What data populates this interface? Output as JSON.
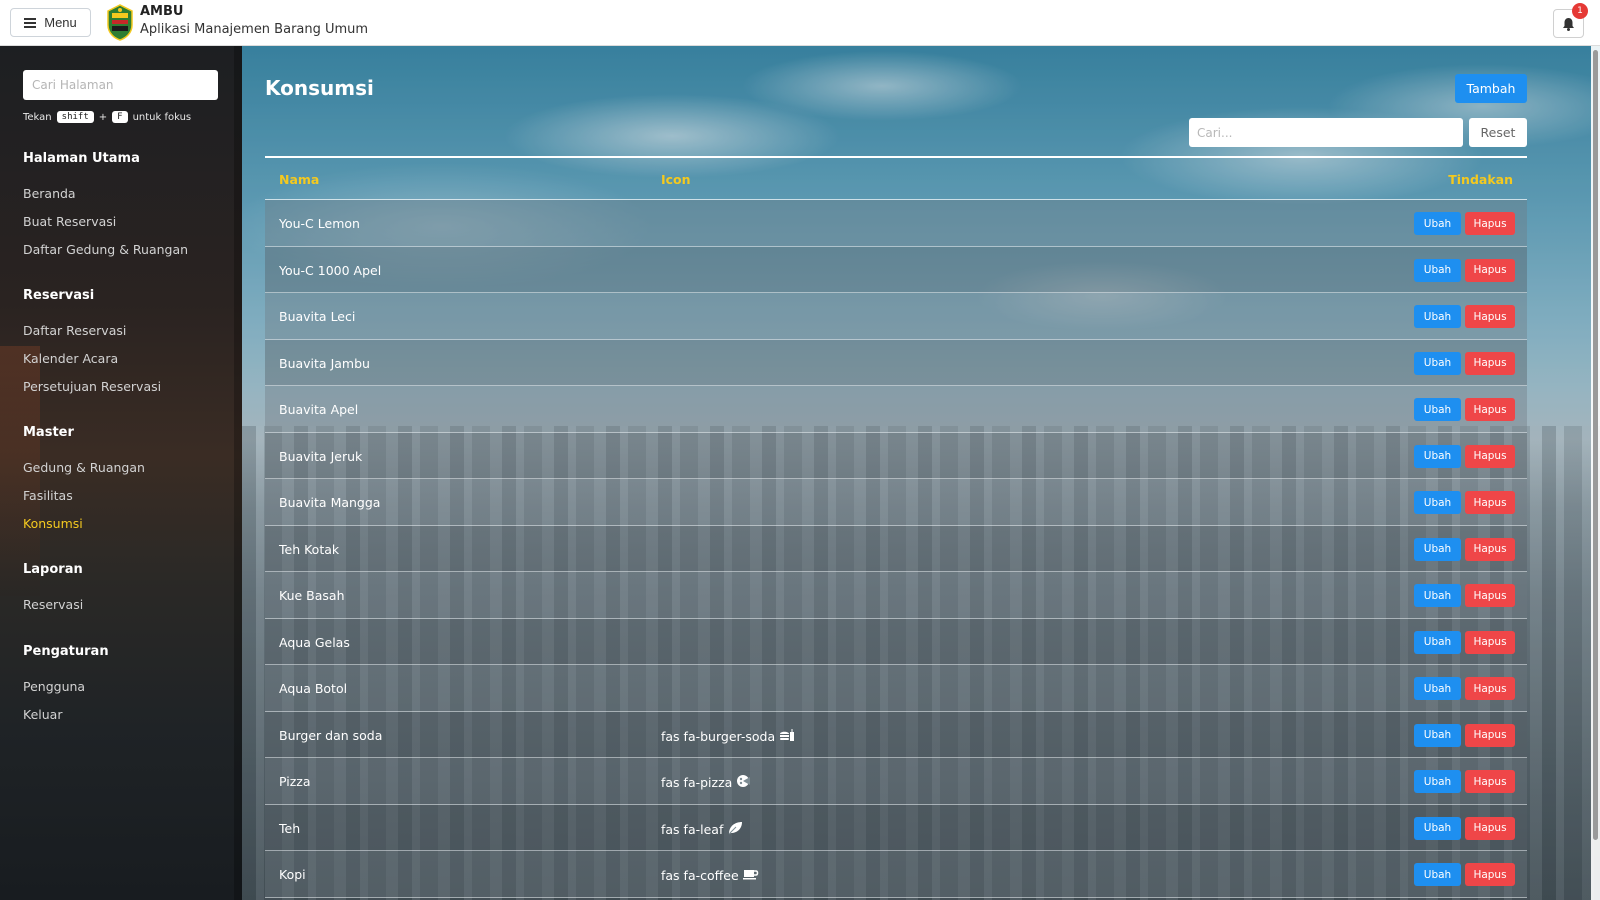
{
  "header": {
    "menu_label": "Menu",
    "app_title": "AMBU",
    "app_subtitle": "Aplikasi Manajemen Barang Umum",
    "notification_count": "1"
  },
  "sidebar": {
    "search_placeholder": "Cari Halaman",
    "hint": {
      "prefix": "Tekan",
      "key1": "shift",
      "plus": "+",
      "key2": "F",
      "suffix": "untuk fokus"
    },
    "sections": [
      {
        "title": "Halaman Utama",
        "items": [
          "Beranda",
          "Buat Reservasi",
          "Daftar Gedung & Ruangan"
        ]
      },
      {
        "title": "Reservasi",
        "items": [
          "Daftar Reservasi",
          "Kalender Acara",
          "Persetujuan Reservasi"
        ]
      },
      {
        "title": "Master",
        "items": [
          "Gedung & Ruangan",
          "Fasilitas",
          "Konsumsi"
        ]
      },
      {
        "title": "Laporan",
        "items": [
          "Reservasi"
        ]
      },
      {
        "title": "Pengaturan",
        "items": [
          "Pengguna",
          "Keluar"
        ]
      }
    ],
    "active_item": "Konsumsi"
  },
  "main": {
    "title": "Konsumsi",
    "add_label": "Tambah",
    "search_placeholder": "Cari...",
    "reset_label": "Reset",
    "columns": {
      "nama": "Nama",
      "icon": "Icon",
      "tindakan": "Tindakan"
    },
    "edit_label": "Ubah",
    "delete_label": "Hapus",
    "rows": [
      {
        "nama": "You-C Lemon",
        "icon": ""
      },
      {
        "nama": "You-C 1000 Apel",
        "icon": ""
      },
      {
        "nama": "Buavita Leci",
        "icon": ""
      },
      {
        "nama": "Buavita Jambu",
        "icon": ""
      },
      {
        "nama": "Buavita Apel",
        "icon": ""
      },
      {
        "nama": "Buavita Jeruk",
        "icon": ""
      },
      {
        "nama": "Buavita Mangga",
        "icon": ""
      },
      {
        "nama": "Teh Kotak",
        "icon": ""
      },
      {
        "nama": "Kue Basah",
        "icon": ""
      },
      {
        "nama": "Aqua Gelas",
        "icon": ""
      },
      {
        "nama": "Aqua Botol",
        "icon": ""
      },
      {
        "nama": "Burger dan soda",
        "icon": "fas fa-burger-soda",
        "glyph": "burger-soda-icon"
      },
      {
        "nama": "Pizza",
        "icon": "fas fa-pizza",
        "glyph": "pizza-icon"
      },
      {
        "nama": "Teh",
        "icon": "fas fa-leaf",
        "glyph": "leaf-icon"
      },
      {
        "nama": "Kopi",
        "icon": "fas fa-coffee",
        "glyph": "coffee-icon"
      }
    ]
  },
  "colors": {
    "accent": "#1e8ff0",
    "danger": "#ef4648",
    "active": "#f4c91f"
  }
}
